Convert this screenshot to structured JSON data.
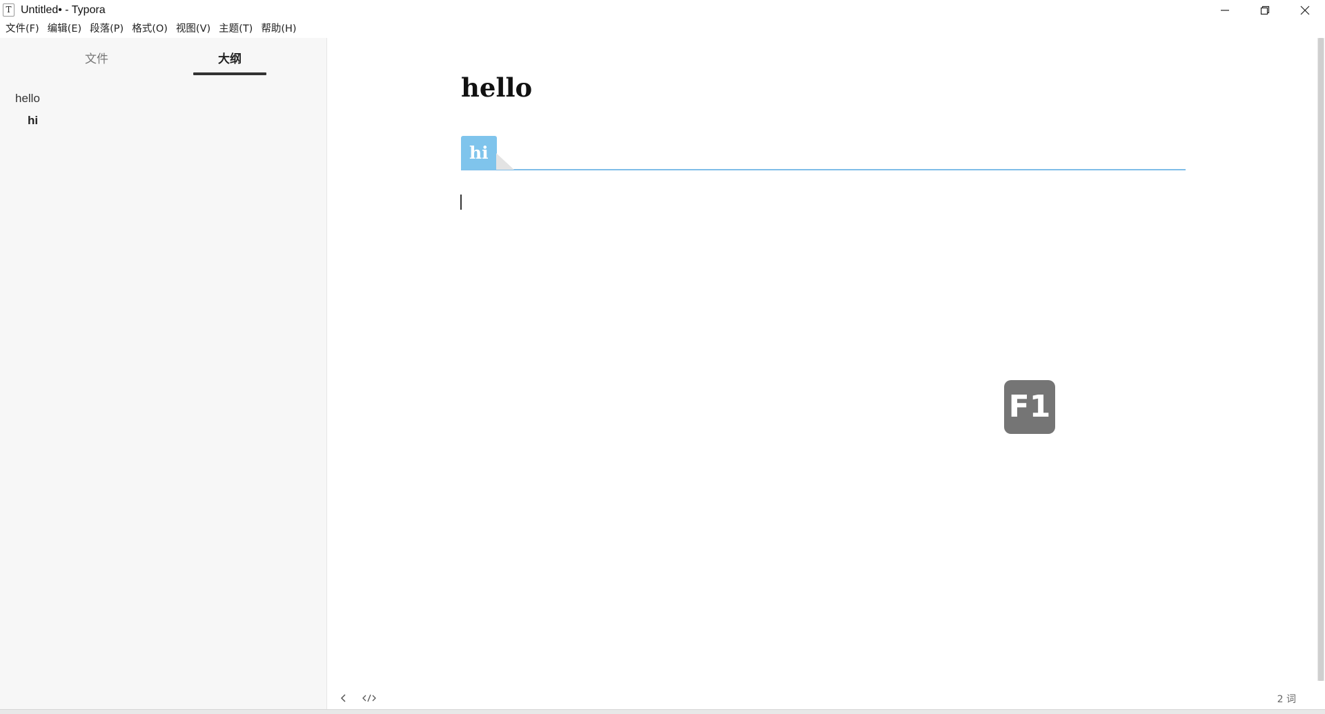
{
  "window": {
    "app_icon_letter": "T",
    "title": "Untitled• - Typora",
    "controls": [
      "minimize-icon",
      "restore-icon",
      "close-icon"
    ]
  },
  "menu": {
    "items": [
      "文件(F)",
      "编辑(E)",
      "段落(P)",
      "格式(O)",
      "视图(V)",
      "主题(T)",
      "帮助(H)"
    ]
  },
  "sidebar": {
    "tabs": [
      "文件",
      "大纲"
    ],
    "active_tab": "大纲",
    "outline": [
      {
        "label": "hello",
        "level": 1
      },
      {
        "label": "hi",
        "level": 2
      }
    ]
  },
  "document": {
    "heading1": "hello",
    "heading2": "hi",
    "accent_color": "#7fc4ec"
  },
  "overlay": {
    "key_badge": "F1"
  },
  "statusbar": {
    "back_icon": "chevron-left-icon",
    "source_icon": "code-icon",
    "word_count": "2 词"
  }
}
